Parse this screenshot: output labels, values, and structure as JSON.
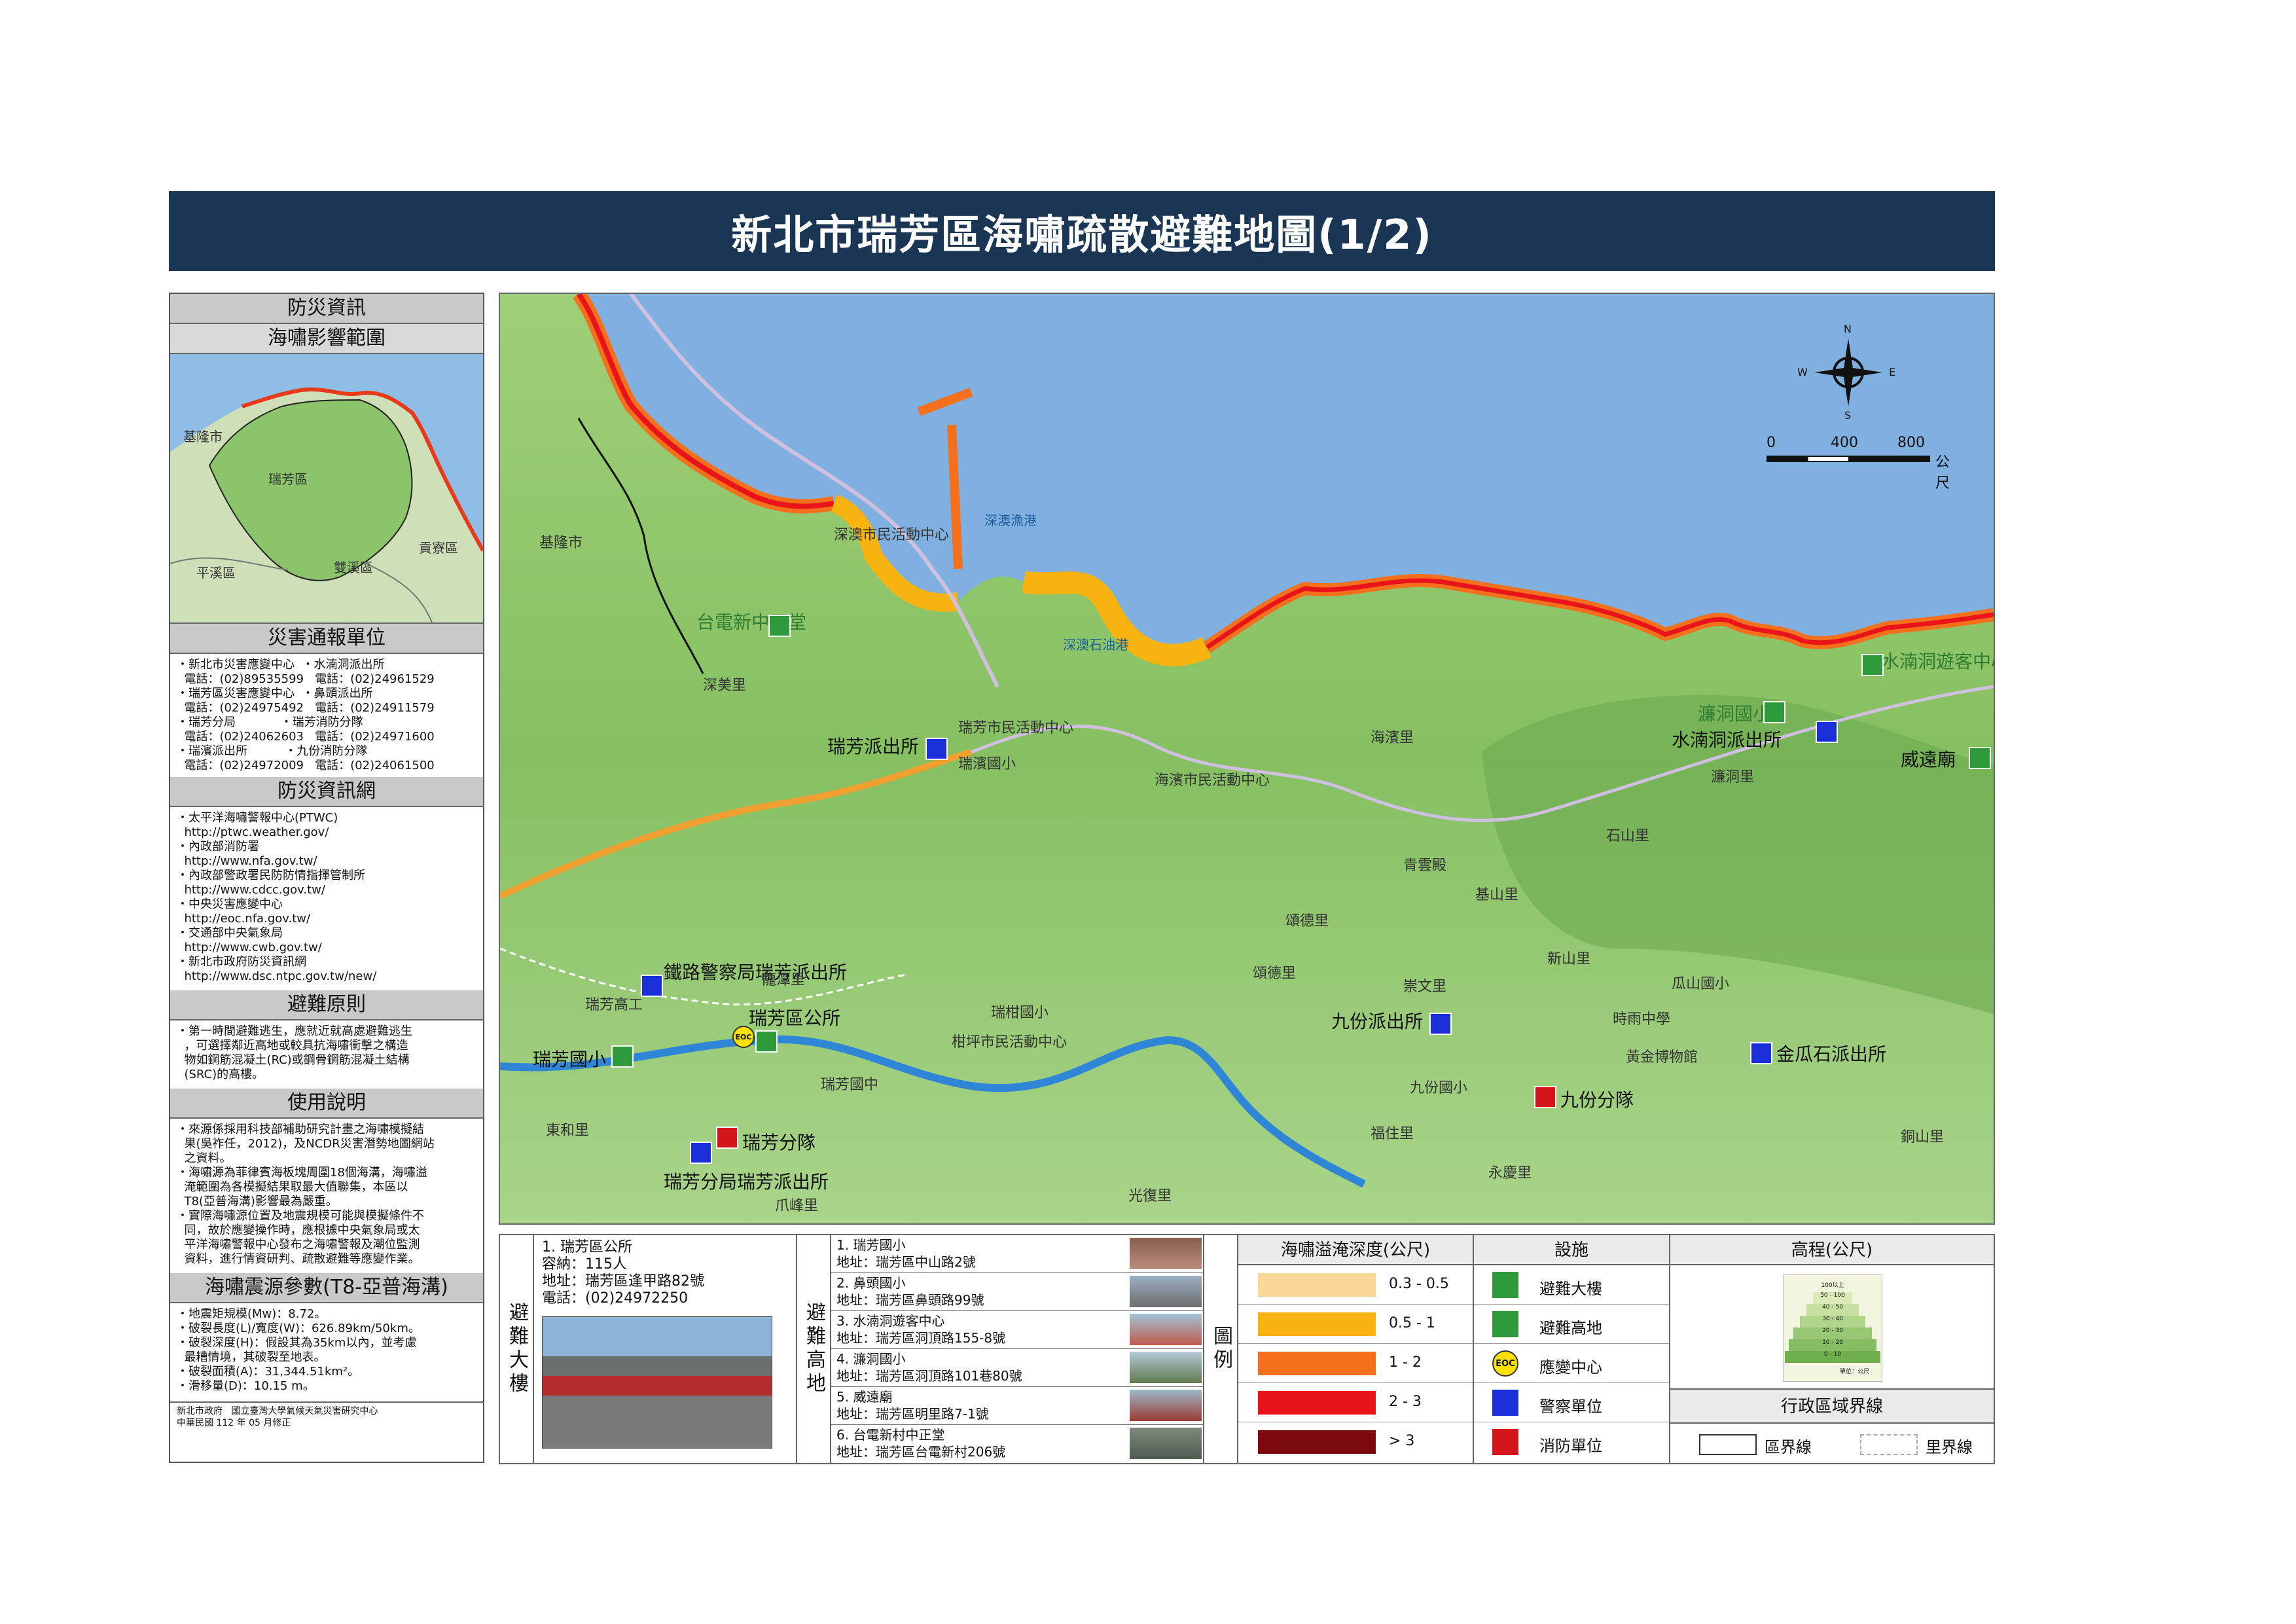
{
  "title": "新北市瑞芳區海嘯疏散避難地圖(1/2)",
  "left": {
    "info_header": "防災資訊",
    "impact_header": "海嘯影響範圍",
    "impact_map_labels": [
      "瑞芳區",
      "基隆市",
      "平溪區",
      "雙溪區",
      "貢寮區"
    ],
    "report_header": "災害通報單位",
    "report_lines": [
      "・新北市災害應變中心  ・水湳洞派出所",
      "  電話：(02)89535599   電話：(02)24961529",
      "・瑞芳區災害應變中心  ・鼻頭派出所",
      "  電話：(02)24975492   電話：(02)24911579",
      "・瑞芳分局            ・瑞芳消防分隊",
      "  電話：(02)24062603   電話：(02)24971600",
      "・瑞濱派出所          ・九份消防分隊",
      "  電話：(02)24972009   電話：(02)24061500"
    ],
    "web_header": "防災資訊網",
    "web_lines": [
      "・太平洋海嘯警報中心(PTWC)",
      "  http://ptwc.weather.gov/",
      "・內政部消防署",
      "  http://www.nfa.gov.tw/",
      "・內政部警政署民防防情指揮管制所",
      "  http://www.cdcc.gov.tw/",
      "・中央災害應變中心",
      "  http://eoc.nfa.gov.tw/",
      "・交通部中央氣象局",
      "  http://www.cwb.gov.tw/",
      "・新北市政府防災資訊網",
      "  http://www.dsc.ntpc.gov.tw/new/"
    ],
    "principle_header": "避難原則",
    "principle_lines": [
      "・第一時間避難逃生，應就近就高處避難逃生",
      "  ，可選擇鄰近高地或較具抗海嘯衝擊之構造",
      "  物如鋼筋混凝土(RC)或鋼骨鋼筋混凝土結構",
      "  (SRC)的高樓。"
    ],
    "usage_header": "使用說明",
    "usage_lines": [
      "・來源係採用科技部補助研究計畫之海嘯模擬結",
      "  果(吳祚任，2012)，及NCDR災害潛勢地圖網站",
      "  之資料。",
      "・海嘯源為菲律賓海板塊周圍18個海溝，海嘯溢",
      "  淹範圍為各模擬結果取最大值聯集，本區以",
      "  T8(亞普海溝)影響最為嚴重。",
      "・實際海嘯源位置及地震規模可能與模擬條件不",
      "  同，故於應變操作時，應根據中央氣象局或太",
      "  平洋海嘯警報中心發布之海嘯警報及潮位監測",
      "  資料，進行情資研判、疏散避難等應變作業。"
    ],
    "params_header": "海嘯震源參數(T8-亞普海溝)",
    "params_lines": [
      "・地震矩規模(Mw)：8.72。",
      "・破裂長度(L)/寬度(W)：626.89km/50km。",
      "・破裂深度(H)：假設其為35km以內，並考慮",
      "  最糟情境，其破裂至地表。",
      "・破裂面積(A)：31,344.51km²。",
      "・滑移量(D)：10.15 m。"
    ],
    "footer_lines": [
      "新北市政府   國立臺灣大學氣候天氣災害研究中心",
      "中華民國 112 年 05 月修正"
    ]
  },
  "map": {
    "compass": {
      "n": "N",
      "s": "S",
      "e": "E",
      "w": "W"
    },
    "scale": {
      "ticks": [
        "0",
        "400",
        "800"
      ],
      "unit": "公尺"
    },
    "sea_labels": [
      "深澳漁港",
      "深澳石油港"
    ],
    "labels": [
      "基隆市",
      "深美里",
      "台電新中正堂",
      "深澳市民活動中心",
      "瑞芳派出所",
      "瑞芳市民活動中心",
      "瑞濱國小",
      "海濱市民活動中心",
      "海濱里",
      "水湳洞遊客中心",
      "濂洞國小",
      "水湳洞派出所",
      "威遠廟",
      "濂洞里",
      "石山里",
      "新山里",
      "瓜山國小",
      "九份派出所",
      "金瓜石派出所",
      "九份分隊",
      "九份國小",
      "黃金博物館",
      "時雨中學",
      "鐵路警察局瑞芳派出所",
      "瑞芳區公所",
      "瑞芳國小",
      "瑞芳分隊",
      "瑞芳分局瑞芳派出所",
      "瑞芳高工",
      "龍潭里",
      "柑坪市民活動中心",
      "瑞柑國小",
      "瑞芳國中",
      "東和里",
      "光復里",
      "爪峰里",
      "福住里",
      "永慶里",
      "銅山里",
      "頌德里",
      "青雲殿",
      "基山里",
      "崇文里",
      "頌德里"
    ]
  },
  "legend": {
    "tall_building_header": "避難大樓",
    "tall_building": {
      "name": "1. 瑞芳區公所",
      "capacity": "容納：115人",
      "address": "地址：瑞芳區逢甲路82號",
      "phone": "電話：(02)24972250"
    },
    "highland_header": "避難高地",
    "highlands": [
      {
        "name": "1. 瑞芳國小",
        "address": "地址：瑞芳區中山路2號"
      },
      {
        "name": "2. 鼻頭國小",
        "address": "地址：瑞芳區鼻頭路99號"
      },
      {
        "name": "3. 水湳洞遊客中心",
        "address": "地址：瑞芳區洞頂路155-8號"
      },
      {
        "name": "4. 濂洞國小",
        "address": "地址：瑞芳區洞頂路101巷80號"
      },
      {
        "name": "5. 威遠廟",
        "address": "地址：瑞芳區明里路7-1號"
      },
      {
        "name": "6. 台電新村中正堂",
        "address": "地址：瑞芳區台電新村206號"
      }
    ],
    "legend_label": "圖例",
    "depth_header": "海嘯溢淹深度(公尺)",
    "depth_classes": [
      {
        "label": "0.3 - 0.5",
        "color": "#f9d89a"
      },
      {
        "label": "0.5 - 1",
        "color": "#f7b30f"
      },
      {
        "label": "1 - 2",
        "color": "#f4701d"
      },
      {
        "label": "2 - 3",
        "color": "#e8141a"
      },
      {
        "label": "> 3",
        "color": "#7a0a0e"
      }
    ],
    "facility_header": "設施",
    "facilities": [
      "避難大樓",
      "避難高地",
      "應變中心",
      "警察單位",
      "消防單位"
    ],
    "eoc_text": "EOC",
    "elevation_header": "高程(公尺)",
    "elevation_classes": [
      "100以上",
      "50 - 100",
      "40 - 50",
      "30 - 40",
      "20 - 30",
      "10 - 20",
      "0 - 10"
    ],
    "elevation_unit": "單位：公尺",
    "boundary_header": "行政區域界線",
    "boundaries": [
      "區界線",
      "里界線"
    ]
  }
}
